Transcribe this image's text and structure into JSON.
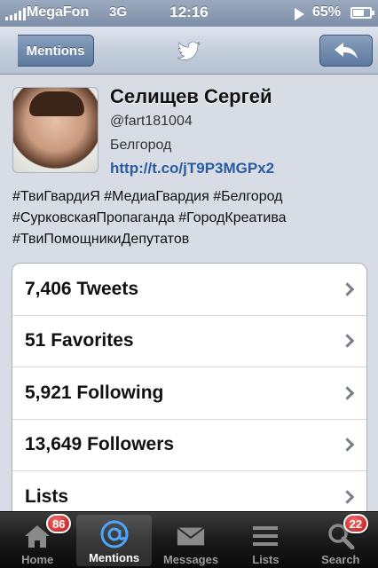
{
  "status_bar": {
    "carrier": "MegaFon",
    "network": "3G",
    "time": "12:16",
    "battery": "65%"
  },
  "nav": {
    "back_label": "Mentions",
    "center_icon": "twitter-bird-icon",
    "right_icon": "reply-arrow-icon"
  },
  "profile": {
    "name": "Селищев Сергей",
    "handle": "@fart181004",
    "location": "Белгород",
    "url": "http://t.co/jT9P3MGPx2",
    "bio_lines": [
      "#ТвиГвардиЯ #МедиаГвардия #Белгород",
      "#СурковскаяПропаганда #ГородКреатива",
      "#ТвиПомощникиДепутатов"
    ]
  },
  "stats": [
    {
      "label": "7,406 Tweets"
    },
    {
      "label": "51 Favorites"
    },
    {
      "label": "5,921 Following"
    },
    {
      "label": "13,649 Followers"
    },
    {
      "label": "Lists"
    }
  ],
  "tabs": [
    {
      "label": "Home",
      "icon": "home-icon",
      "badge": "86"
    },
    {
      "label": "Mentions",
      "icon": "at-sign-icon",
      "badge": "",
      "active": true
    },
    {
      "label": "Messages",
      "icon": "envelope-icon",
      "badge": ""
    },
    {
      "label": "Lists",
      "icon": "list-icon",
      "badge": ""
    },
    {
      "label": "Search",
      "icon": "search-icon",
      "badge": "22"
    }
  ],
  "colors": {
    "link": "#2a5ba0",
    "badge": "#c41616",
    "nav_button": "#5c7a9f"
  }
}
